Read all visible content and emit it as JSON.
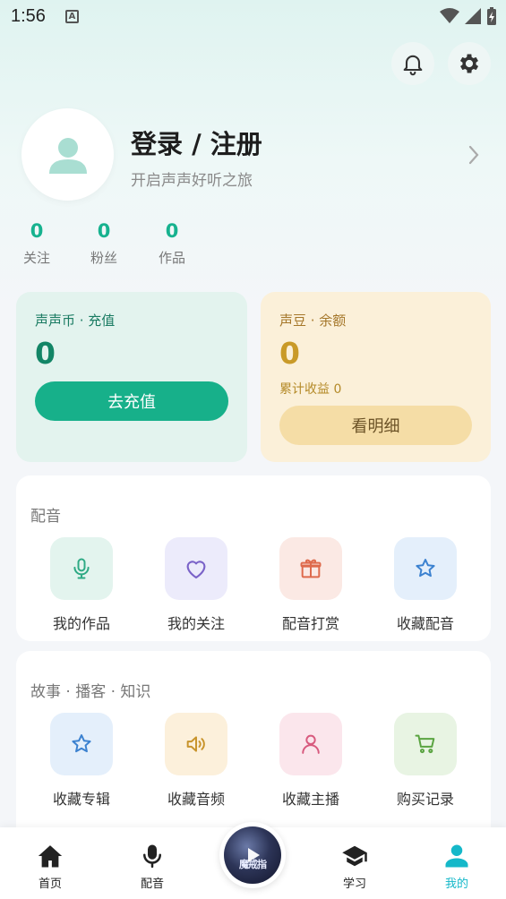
{
  "status": {
    "time": "1:56",
    "a_icon": "A"
  },
  "profile": {
    "login_label": "登录 / 注册",
    "subtitle": "开启声声好听之旅"
  },
  "stats": [
    {
      "value": "0",
      "label": "关注"
    },
    {
      "value": "0",
      "label": "粉丝"
    },
    {
      "value": "0",
      "label": "作品"
    }
  ],
  "coin_card": {
    "label": "声声币 · 充值",
    "value": "0",
    "button": "去充值",
    "accent": "#17b08a"
  },
  "bean_card": {
    "label": "声豆 · 余额",
    "value": "0",
    "earnings": "累计收益 0",
    "button": "看明细",
    "accent": "#c99a28"
  },
  "dubbing_section": {
    "title": "配音",
    "items": [
      {
        "label": "我的作品",
        "icon": "microphone-icon"
      },
      {
        "label": "我的关注",
        "icon": "heart-icon"
      },
      {
        "label": "配音打赏",
        "icon": "gift-icon"
      },
      {
        "label": "收藏配音",
        "icon": "star-icon"
      }
    ]
  },
  "story_section": {
    "title": "故事 · 播客 · 知识",
    "items": [
      {
        "label": "收藏专辑",
        "icon": "star-icon"
      },
      {
        "label": "收藏音频",
        "icon": "speaker-icon"
      },
      {
        "label": "收藏主播",
        "icon": "person-icon"
      },
      {
        "label": "购买记录",
        "icon": "cart-icon"
      }
    ]
  },
  "tabbar": {
    "items": [
      {
        "label": "首页",
        "icon": "home-icon"
      },
      {
        "label": "配音",
        "icon": "microphone-icon"
      },
      {
        "label": "学习",
        "icon": "graduation-cap-icon"
      },
      {
        "label": "我的",
        "icon": "person-icon",
        "active": true
      }
    ],
    "player_cover_text": "魔戒指",
    "active_color": "#15b8c9"
  }
}
